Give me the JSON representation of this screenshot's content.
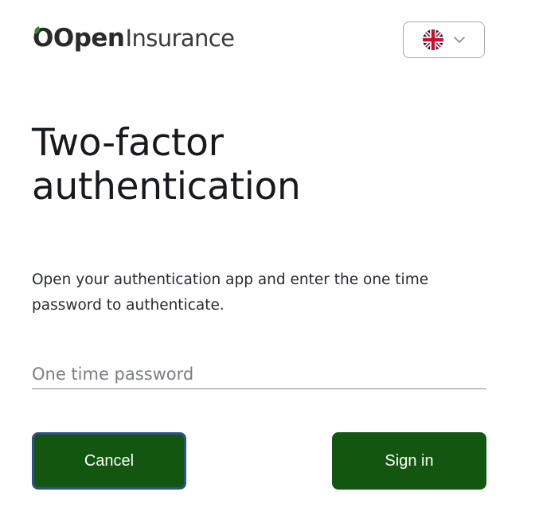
{
  "header": {
    "logo": {
      "part_bold": "Open",
      "part_light": "Insurance"
    },
    "language_selector": {
      "flag_icon": "uk-flag-icon",
      "chevron_icon": "chevron-down-icon"
    }
  },
  "main": {
    "title": "Two-factor authentication",
    "instructions": "Open your authentication app and enter the one time password to authenticate.",
    "otp_input": {
      "value": "",
      "placeholder": "One time password"
    },
    "buttons": {
      "cancel_label": "Cancel",
      "signin_label": "Sign in"
    }
  },
  "colors": {
    "brand_green": "#12560f",
    "logo_leaf_green": "#2e8b2e",
    "focus_outline": "#2d5287",
    "text_dark": "#16191d",
    "placeholder": "#7b7f85"
  }
}
